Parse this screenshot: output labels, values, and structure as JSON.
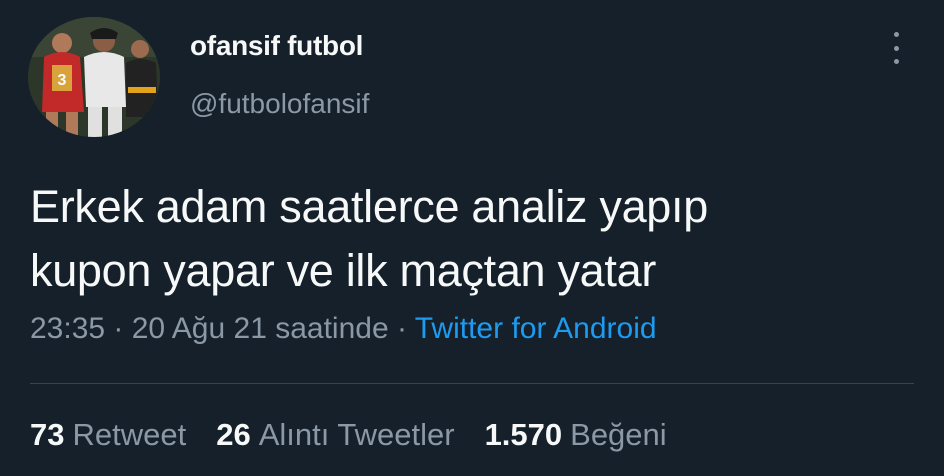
{
  "author": {
    "display_name": "ofansif futbol",
    "handle": "@futbolofansif",
    "avatar_icon": "football-players-photo"
  },
  "menu_icon": "more-vertical-icon",
  "tweet": {
    "text_line1": "Erkek adam saatlerce analiz yapıp",
    "text_line2": "kupon yapar ve ilk maçtan yatar"
  },
  "meta": {
    "time": "23:35",
    "separator1": " · ",
    "date": "20 Ağu 21 saatinde",
    "separator2": " · ",
    "source": "Twitter for Android"
  },
  "stats": [
    {
      "count": "73",
      "label": "Retweet"
    },
    {
      "count": "26",
      "label": "Alıntı Tweetler"
    },
    {
      "count": "1.570",
      "label": "Beğeni"
    }
  ],
  "colors": {
    "background": "#15202b",
    "text": "#f7f9f9",
    "muted": "#8b98a5",
    "link": "#1d9bf0",
    "divider": "#38444d"
  }
}
